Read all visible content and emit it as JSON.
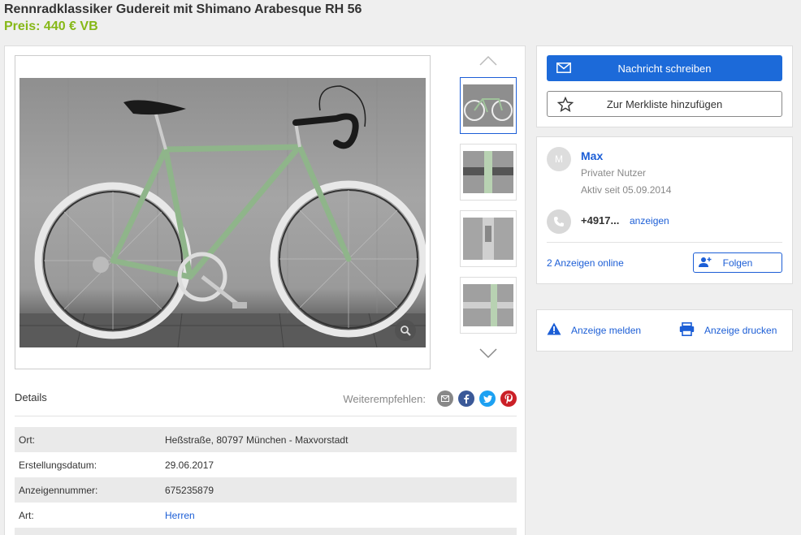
{
  "listing": {
    "title": "Rennradklassiker Gudereit mit Shimano Arabesque RH 56",
    "price": "Preis: 440 € VB"
  },
  "gallery": {
    "thumbnail_count": 4,
    "active_thumbnail": 1
  },
  "details": {
    "heading": "Details",
    "share_label": "Weiterempfehlen:",
    "share_buttons": [
      "email-icon",
      "facebook-icon",
      "twitter-icon",
      "pinterest-icon"
    ],
    "rows": [
      {
        "key": "Ort:",
        "value": "Heßstraße, 80797 München - Maxvorstadt"
      },
      {
        "key": "Erstellungsdatum:",
        "value": "29.06.2017"
      },
      {
        "key": "Anzeigennummer:",
        "value": "675235879"
      },
      {
        "key": "Art:",
        "value": "Herren"
      }
    ]
  },
  "contact": {
    "message_label": "Nachricht schreiben",
    "watchlist_label": "Zur Merkliste hinzufügen"
  },
  "seller": {
    "avatar_letter": "M",
    "name": "Max",
    "type": "Privater Nutzer",
    "active_since": "Aktiv seit 05.09.2014",
    "phone": "+4917...",
    "phone_show": "anzeigen",
    "ads_online": "2 Anzeigen online",
    "follow_label": "Folgen"
  },
  "actions": {
    "report_label": "Anzeige melden",
    "print_label": "Anzeige drucken"
  },
  "colors": {
    "accent": "#1c6ad9",
    "price": "#86b817",
    "facebook": "#3b5998",
    "twitter": "#1da1f2",
    "pinterest": "#cb2027",
    "email": "#888888"
  }
}
